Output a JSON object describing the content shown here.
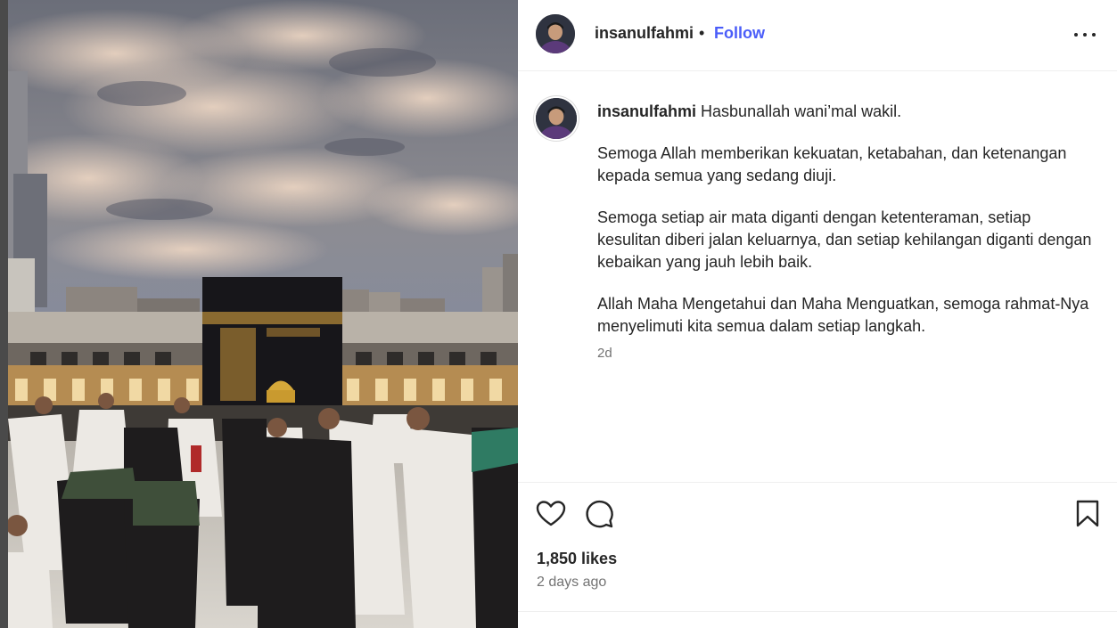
{
  "post": {
    "username": "insanulfahmi",
    "separator": "•",
    "follow_label": "Follow",
    "caption_username": "insanulfahmi",
    "caption_lines": [
      "Hasbunallah wani’mal wakil.",
      "Semoga Allah memberikan kekuatan, ketabahan, dan ketenangan kepada semua yang sedang diuji.",
      "Semoga setiap air mata diganti dengan ketenteraman, setiap kesulitan diberi jalan keluarnya, dan setiap kehilangan diganti dengan kebaikan yang jauh lebih baik.",
      "Allah Maha Mengetahui dan Maha Menguatkan, semoga rahmat-Nya menyelimuti kita semua dalam setiap langkah."
    ],
    "caption_time": "2d",
    "likes": "1,850 likes",
    "time_ago": "2 days ago"
  },
  "icons": {
    "more": "more-options-icon",
    "like": "heart-icon",
    "comment": "comment-icon",
    "save": "bookmark-icon"
  },
  "colors": {
    "follow": "#4a5df9",
    "text": "#262626",
    "muted": "#737373",
    "divider": "#efefef"
  }
}
